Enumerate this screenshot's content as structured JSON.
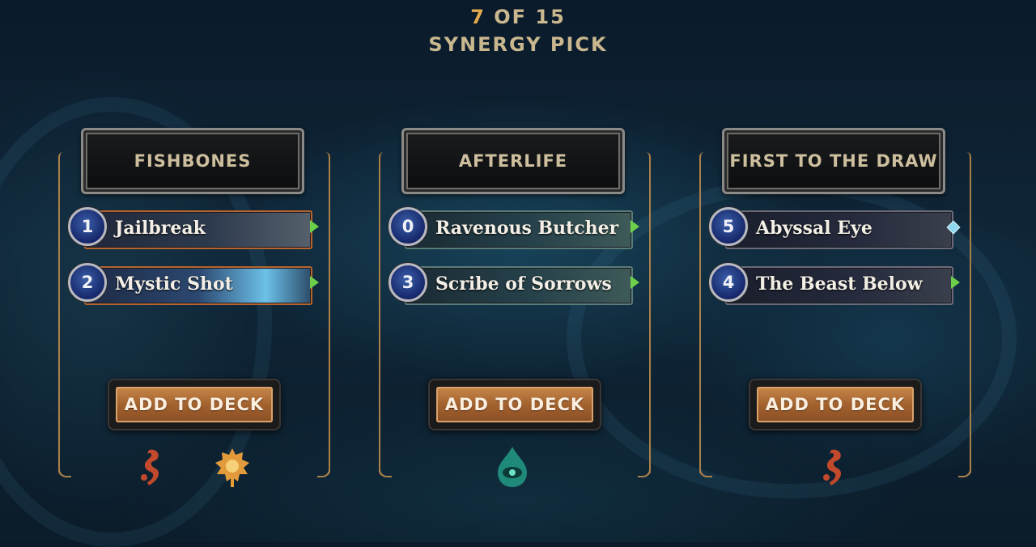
{
  "progress": {
    "current": "7",
    "separator": " OF ",
    "total": "15"
  },
  "subtitle": "SYNERGY PICK",
  "panels": [
    {
      "title": "FISHBONES",
      "cards": [
        {
          "cost": "1",
          "name": "Jailbreak"
        },
        {
          "cost": "2",
          "name": "Mystic Shot"
        }
      ],
      "button": "ADD TO DECK",
      "regions": [
        "bilgewater-icon",
        "piltover-zaun-icon"
      ]
    },
    {
      "title": "AFTERLIFE",
      "cards": [
        {
          "cost": "0",
          "name": "Ravenous Butcher"
        },
        {
          "cost": "3",
          "name": "Scribe of Sorrows"
        }
      ],
      "button": "ADD TO DECK",
      "regions": [
        "shadow-isles-icon"
      ]
    },
    {
      "title": "FIRST TO THE DRAW",
      "cards": [
        {
          "cost": "5",
          "name": "Abyssal Eye"
        },
        {
          "cost": "4",
          "name": "The Beast Below"
        }
      ],
      "button": "ADD TO DECK",
      "regions": [
        "bilgewater-icon"
      ]
    }
  ],
  "colors": {
    "accent_gold": "#e4a94e",
    "text_gold": "#c9b78e",
    "button_orange": "#a3622e"
  }
}
